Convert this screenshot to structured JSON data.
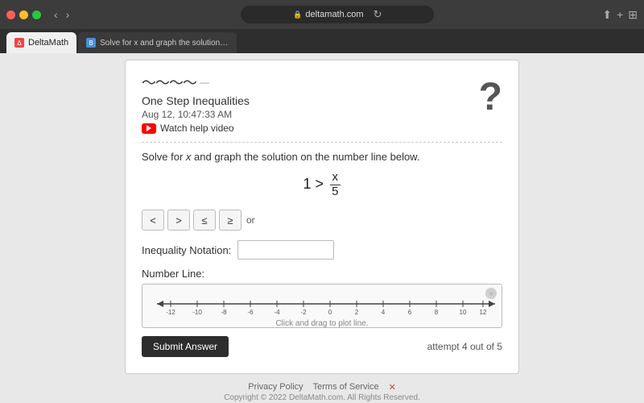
{
  "browser": {
    "url": "deltamath.com",
    "tab1_label": "DeltaMath",
    "tab2_label": "Solve for x and graph the solution on the number line below. – Brainly.com",
    "reload_icon": "↻"
  },
  "header": {
    "logo_text": "DeltaMath",
    "logo_dash": "—",
    "problem_title": "One Step Inequalities",
    "problem_date": "Aug 12, 10:47:33 AM",
    "watch_help_label": "Watch help video",
    "question_mark": "?"
  },
  "problem": {
    "instruction": "Solve for x and graph the solution on the number line below.",
    "equation_left": "1 >",
    "equation_frac_num": "x",
    "equation_frac_den": "5"
  },
  "operators": {
    "buttons": [
      "<",
      ">",
      "≤",
      "≥"
    ],
    "or_label": "or"
  },
  "inequality_notation": {
    "label": "Inequality Notation:",
    "placeholder": ""
  },
  "number_line": {
    "label": "Number Line:",
    "ticks": [
      "-12",
      "-10",
      "-8",
      "-6",
      "-4",
      "-2",
      "0",
      "2",
      "4",
      "6",
      "8",
      "10",
      "12"
    ],
    "click_hint": "Click and drag to plot line."
  },
  "submit": {
    "button_label": "Submit Answer",
    "attempt_text": "attempt 4 out of 5"
  },
  "footer": {
    "privacy_label": "Privacy Policy",
    "terms_label": "Terms of Service",
    "copyright": "Copyright © 2022 DeltaMath.com. All Rights Reserved.",
    "close_icon": "✕"
  }
}
